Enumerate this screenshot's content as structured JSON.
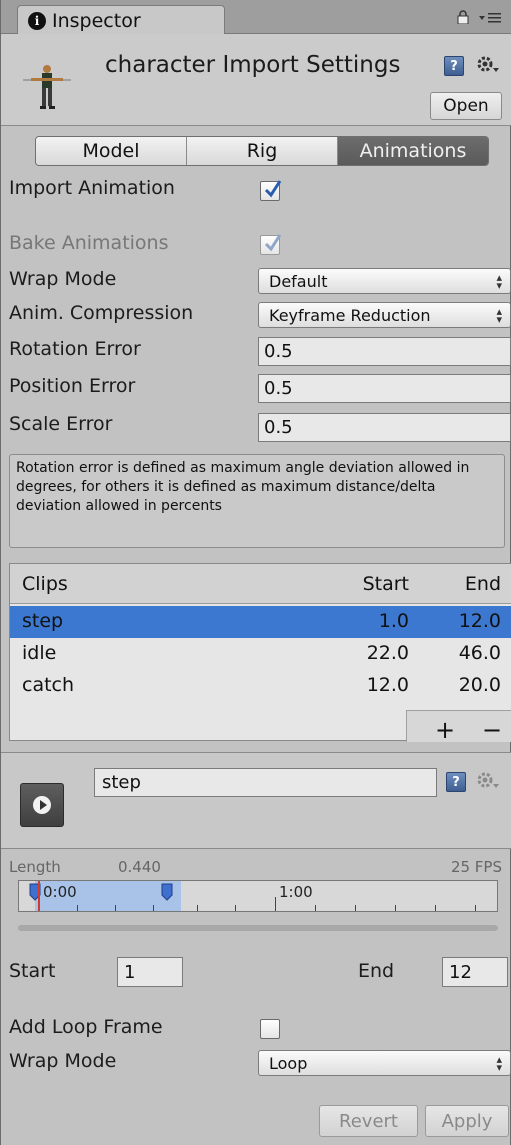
{
  "tab": {
    "label": "Inspector"
  },
  "header": {
    "title": "character Import Settings",
    "open_label": "Open"
  },
  "toolbar": {
    "tabs": [
      "Model",
      "Rig",
      "Animations"
    ],
    "active": "Animations"
  },
  "import": {
    "import_animation_label": "Import Animation",
    "import_animation_checked": true,
    "bake_animations_label": "Bake Animations",
    "bake_animations_checked": true,
    "wrap_mode_label": "Wrap Mode",
    "wrap_mode_value": "Default",
    "anim_compression_label": "Anim. Compression",
    "anim_compression_value": "Keyframe Reduction",
    "rotation_error_label": "Rotation Error",
    "rotation_error_value": "0.5",
    "position_error_label": "Position Error",
    "position_error_value": "0.5",
    "scale_error_label": "Scale Error",
    "scale_error_value": "0.5",
    "help_text": "Rotation error is defined as maximum angle deviation allowed in degrees, for others it is defined as maximum distance/delta deviation allowed in percents"
  },
  "clips": {
    "headers": {
      "name": "Clips",
      "start": "Start",
      "end": "End"
    },
    "rows": [
      {
        "name": "step",
        "start": "1.0",
        "end": "12.0",
        "selected": true
      },
      {
        "name": "idle",
        "start": "22.0",
        "end": "46.0",
        "selected": false
      },
      {
        "name": "catch",
        "start": "12.0",
        "end": "20.0",
        "selected": false
      }
    ],
    "add_label": "+",
    "remove_label": "−"
  },
  "clip": {
    "name": "step",
    "length_label": "Length",
    "length_value": "0.440",
    "fps": "25 FPS",
    "timeline_labels": [
      "0:00",
      "1:00"
    ],
    "start_label": "Start",
    "start_value": "1",
    "end_label": "End",
    "end_value": "12",
    "add_loop_frame_label": "Add Loop Frame",
    "add_loop_frame_checked": false,
    "wrap_mode_label": "Wrap Mode",
    "wrap_mode_value": "Loop"
  },
  "buttons": {
    "revert": "Revert",
    "apply": "Apply"
  },
  "colors": {
    "selection": "#3c78d0",
    "active_tab": "#5a5a5a",
    "panel": "#c2c2c2"
  }
}
